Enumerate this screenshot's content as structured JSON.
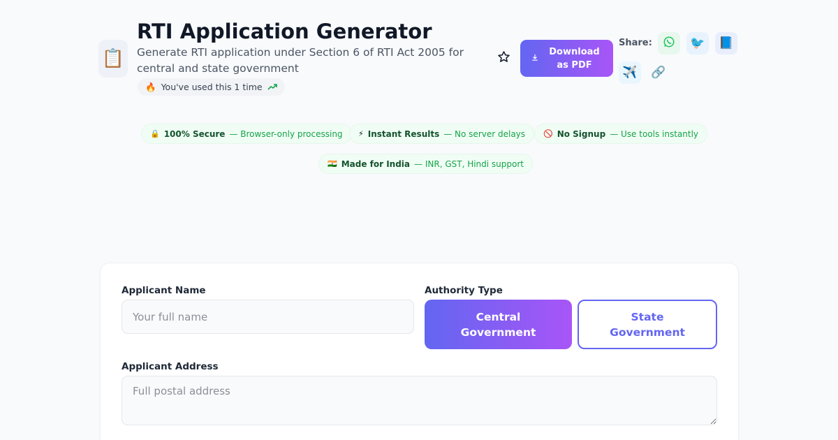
{
  "header": {
    "app_icon": "clipboard-icon",
    "app_icon_glyph": "📋",
    "title": "RTI Application Generator",
    "subtitle": "Generate RTI application under Section 6 of RTI Act 2005 for central and state government",
    "usage_icon": "🔥",
    "usage_text": "You've used this 1 time",
    "usage_trend_icon": "trending-up-icon"
  },
  "actions": {
    "favorite_icon": "star-outline-icon",
    "download_icon": "download-icon",
    "download_label": "Download as PDF",
    "share_label": "Share:",
    "share_buttons": [
      {
        "icon": "whatsapp-icon",
        "glyph": "✆",
        "bg": "#e8f8ee",
        "color": "#22c55e"
      },
      {
        "icon": "twitter-bird-icon",
        "glyph": "🐦",
        "bg": "#e8f3fd",
        "color": "#1d9bf0"
      },
      {
        "icon": "facebook-book-icon",
        "glyph": "📘",
        "bg": "#e8eefb",
        "color": "#1877f2"
      },
      {
        "icon": "telegram-plane-icon",
        "glyph": "✈️",
        "bg": "#eaf6fd",
        "color": "#229ed9"
      },
      {
        "icon": "link-icon",
        "glyph": "🔗",
        "bg": "transparent",
        "color": "#6b7280"
      }
    ]
  },
  "trust_badges": [
    {
      "icon": "🔒",
      "icon_name": "lock-icon",
      "strong": "100% Secure",
      "desc": "— Browser-only processing"
    },
    {
      "icon": "⚡",
      "icon_name": "lightning-icon",
      "strong": "Instant Results",
      "desc": "— No server delays"
    },
    {
      "icon": "🚫",
      "icon_name": "no-entry-icon",
      "strong": "No Signup",
      "desc": "— Use tools instantly"
    },
    {
      "icon": "🇮🇳",
      "icon_name": "india-flag-icon",
      "strong": "Made for India",
      "desc": "— INR, GST, Hindi support"
    }
  ],
  "form": {
    "applicant_name_label": "Applicant Name",
    "applicant_name_value": "",
    "applicant_name_placeholder": "Your full name",
    "authority_type_label": "Authority Type",
    "authority_options": [
      "Central Government",
      "State Government"
    ],
    "authority_selected": "Central Government",
    "applicant_address_label": "Applicant Address",
    "applicant_address_value": "",
    "applicant_address_placeholder": "Full postal address"
  },
  "colors": {
    "accent_start": "#6366f1",
    "accent_end": "#a855f7",
    "badge_bg": "#f0fdf4",
    "badge_text": "#16a34a",
    "page_bg": "#f8fafc"
  }
}
